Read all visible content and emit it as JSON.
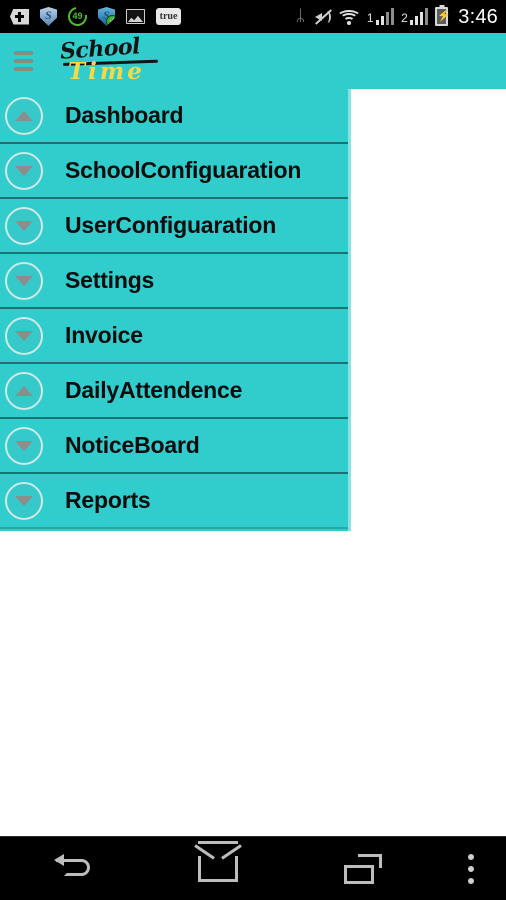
{
  "status_bar": {
    "icons": [
      {
        "name": "add-widget-icon",
        "label": "+"
      },
      {
        "name": "security-shield-icon",
        "label": "S"
      },
      {
        "name": "optimizer-progress-icon",
        "label": "49"
      },
      {
        "name": "security-shield-ok-icon",
        "label": "S",
        "badge": "✓"
      },
      {
        "name": "gallery-photo-icon",
        "label": ""
      },
      {
        "name": "true-app-icon",
        "label": "true"
      },
      {
        "name": "bluetooth-icon",
        "label": "ᛦ"
      },
      {
        "name": "ringer-muted-icon",
        "label": ""
      },
      {
        "name": "wifi-icon",
        "label": ""
      },
      {
        "name": "sim1-signal-icon",
        "label": "1"
      },
      {
        "name": "sim2-signal-icon",
        "label": "2"
      },
      {
        "name": "battery-charging-icon",
        "label": "⚡"
      }
    ],
    "sim1_label": "1",
    "sim2_label": "2",
    "clock": "3:46"
  },
  "app_bar": {
    "menu_icon": "hamburger-menu-icon",
    "brand_line1": "School",
    "brand_line2": "Time"
  },
  "drawer": {
    "items": [
      {
        "label": "Dashboard",
        "state": "up",
        "icon": "chevron-up-circle-icon"
      },
      {
        "label": "SchoolConfiguaration",
        "state": "down",
        "icon": "chevron-down-circle-icon"
      },
      {
        "label": "UserConfiguaration",
        "state": "down",
        "icon": "chevron-down-circle-icon"
      },
      {
        "label": "Settings",
        "state": "down",
        "icon": "chevron-down-circle-icon"
      },
      {
        "label": "Invoice",
        "state": "down",
        "icon": "chevron-down-circle-icon"
      },
      {
        "label": "DailyAttendence",
        "state": "up",
        "icon": "chevron-up-circle-icon"
      },
      {
        "label": "NoticeBoard",
        "state": "down",
        "icon": "chevron-down-circle-icon"
      },
      {
        "label": "Reports",
        "state": "down",
        "icon": "chevron-down-circle-icon"
      }
    ]
  },
  "nav_bar": {
    "back_label": "Back",
    "home_label": "Home",
    "recents_label": "Recent apps",
    "overflow_label": "More options"
  },
  "colors": {
    "teal": "#31cccc",
    "teal_border": "#86e3e3",
    "divider": "#1d6f72",
    "brand_yellow": "#f5d949",
    "status_bar_bg": "#000000",
    "content_bg": "#ffffff"
  }
}
